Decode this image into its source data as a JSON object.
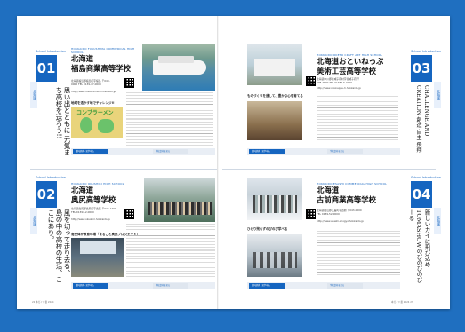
{
  "page": {
    "left_footer": "22 本ガイド書 2024",
    "right_footer": "本ガイド書 2024 23"
  },
  "cards": [
    {
      "num": "01",
      "num_label": "School Introduction",
      "side_label": "北海道",
      "school_en": "HOKKAIDO FUKUSHIMA COMMERCIAL HIGH SCHOOL",
      "school_name_line1": "北海道",
      "school_name_line2": "福島商業高等学校",
      "addr": "北海道福島郡福島町字福島 〒049-0000 TEL 0139-47-0000",
      "site": "http://www.fukushima-h.hokkaido.jp",
      "caption": "地域を活かす地でチャレンジ!!",
      "vertical_copy": "思い出とともに 元気まち高校を送ろう!!",
      "cta1": "資料請求・見学申込",
      "cta2": "学校案内を見る"
    },
    {
      "num": "03",
      "num_label": "School Introduction",
      "side_label": "北海道",
      "school_en": "HOKKAIDO OKETO CRAFT ART HIGH SCHOOL",
      "school_name_line1": "北海道おといねっぷ",
      "school_name_line2": "美術工芸高等学校",
      "addr": "北海道中川郡音威子府村字音威子府 〒098-2500 TEL 01656-5-0000",
      "site": "http://www.otoineppu-h.hokkaido.jp",
      "caption": "ものづくりを通して、豊かな心を育てる",
      "vertical_copy": "CHALLENGE AND CREATION 創造 自主 飛翔",
      "cta1": "資料請求・見学申込",
      "cta2": "学校案内を見る"
    },
    {
      "num": "02",
      "num_label": "School Introduction",
      "side_label": "北海道",
      "school_en": "HOKKAIDO OKUSHIRI HIGH SCHOOL",
      "school_name_line1": "北海道",
      "school_name_line2": "奥尻高等学校",
      "addr": "北海道奥尻郡奥尻町字奥尻 〒043-1400 TEL 01397-2-0000",
      "site": "http://www.okushiri.hokkaido.jp",
      "caption": "島全体が教育の場「まるごと奥尻プロジェクト」",
      "vertical_copy": "風を切って走り去る、 島の中の高校の生活、ここにあり。",
      "cta1": "資料請求・見学申込",
      "cta2": "学校案内を見る"
    },
    {
      "num": "04",
      "num_label": "School Introduction",
      "side_label": "北海道",
      "school_en": "HOKKAIDO ESASHI COMMERCIAL HIGH SCHOOL",
      "school_name_line1": "北海道",
      "school_name_line2": "古前商業高等学校",
      "addr": "北海道檜山郡江差町字古前 〒043-0000 TEL 0139-52-0000",
      "site": "http://www.esashi-shogyo.hokkaido.jp",
      "caption": "ひとり残らずのびのび学べる",
      "vertical_copy": "新しいカイに飛び込め！ TOMASHOWのびのびのびーる",
      "cta1": "資料請求・見学申込",
      "cta2": "学校案内を見る"
    }
  ]
}
